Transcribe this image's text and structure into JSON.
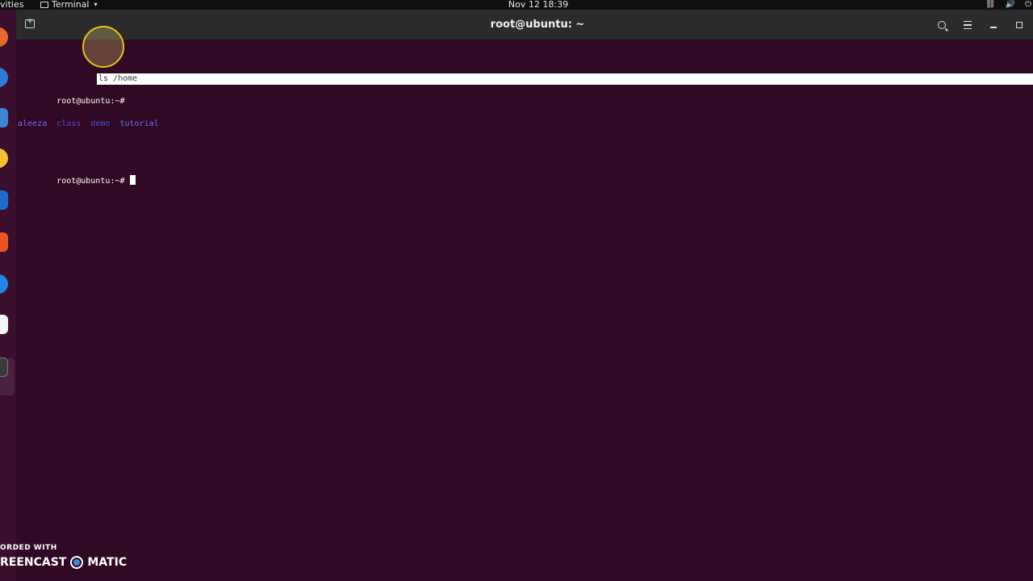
{
  "top_panel": {
    "activities_label": "vities",
    "app_name": "Terminal",
    "app_menu_caret": "▾",
    "clock": "Nov 12  18:39",
    "tray": {
      "network_icon": "network-icon",
      "volume_icon": "volume-icon",
      "power_icon": "power-icon"
    }
  },
  "dock": {
    "apps": [
      {
        "name": "firefox-icon",
        "color": "#e8672a"
      },
      {
        "name": "thunderbird-icon",
        "color": "#2f7ad8"
      },
      {
        "name": "files-icon",
        "color": "#3d85d6"
      },
      {
        "name": "rhythmbox-icon",
        "color": "#f2c230"
      },
      {
        "name": "writer-icon",
        "color": "#1f6bc9"
      },
      {
        "name": "software-icon",
        "color": "#e95420"
      },
      {
        "name": "help-icon",
        "color": "#1e88e5"
      },
      {
        "name": "amazon-icon",
        "color": "#f5f5f5"
      },
      {
        "name": "terminal-icon",
        "color": "#3a3a3a"
      }
    ]
  },
  "window": {
    "title": "root@ubuntu: ~",
    "controls": {
      "search_icon": "search-icon",
      "menu_icon": "hamburger-menu-icon",
      "minimize": "minimize-icon",
      "restore": "restore-icon"
    }
  },
  "terminal": {
    "prompt": "root@ubuntu:~#",
    "command": "ls /home",
    "ls_output": [
      "aleeza",
      "class",
      "demo",
      "tutorial"
    ]
  },
  "watermark": {
    "line1": "ORDED WITH",
    "line2a": "REENCAST",
    "line2b": "MATIC"
  },
  "colors": {
    "terminal_bg": "#300a24",
    "titlebar_bg": "#2b2b2b",
    "directory_blue": "#6c6cff",
    "highlight_yellow": "#e3c21a"
  }
}
